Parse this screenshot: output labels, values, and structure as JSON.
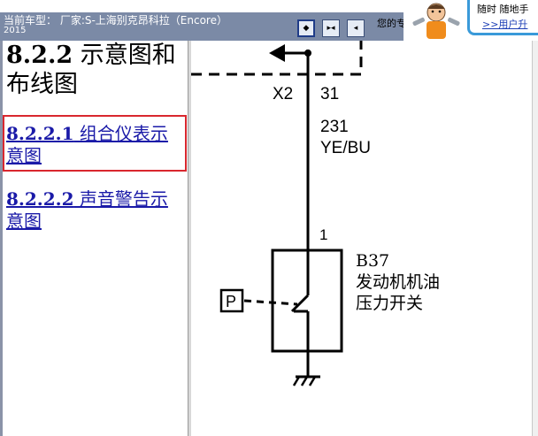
{
  "header": {
    "vehicle_label": "当前车型：  厂家:S-上海别克昂科拉（Encore）",
    "vehicle_year": "2015",
    "greeting": "您的专",
    "toolbar": [
      {
        "icon": "single-pane-icon",
        "glyph": "◆",
        "active": true
      },
      {
        "icon": "split-pane-icon",
        "glyph": "▸◂",
        "active": false
      },
      {
        "icon": "nav-pane-icon",
        "glyph": "◂",
        "active": false
      }
    ],
    "promo_text": "随时 随地手",
    "promo_link": ">>用户升"
  },
  "sidebar": {
    "section_number": "8.2.2",
    "section_title": " 示意图和布线图",
    "items": [
      {
        "number": "8.2.2.1",
        "label": " 组合仪表示意图",
        "selected": true
      },
      {
        "number": "8.2.2.2",
        "label": " 声音警告示意图",
        "selected": false
      }
    ]
  },
  "diagram": {
    "connector": "X2",
    "connector_pin": "31",
    "circuit_number": "231",
    "wire_color": "YE/BU",
    "component_pin": "1",
    "component_id": "B37",
    "component_name_line1": "发动机机油",
    "component_name_line2": "压力开关",
    "pressure_symbol": "P"
  },
  "colors": {
    "header_strip": "#7b8aa6",
    "link": "#1a1aa8",
    "selected_border": "#d9272e",
    "promo_border": "#3a9ad9"
  }
}
